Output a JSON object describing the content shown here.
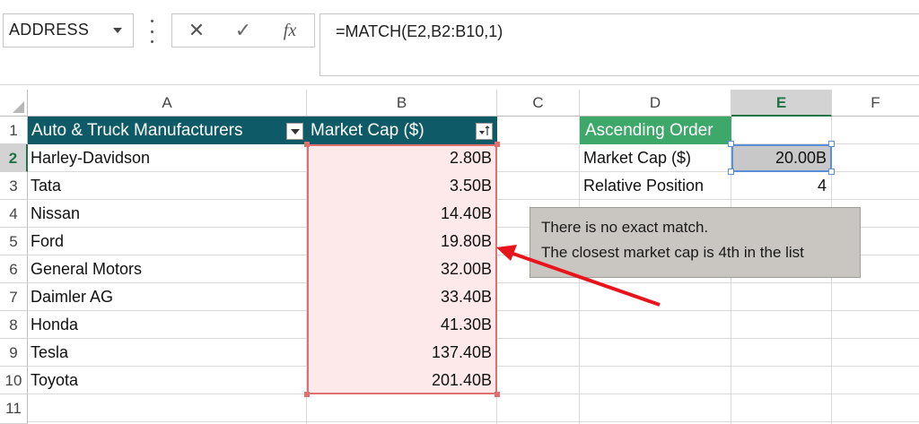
{
  "formula_bar": {
    "name_box": "ADDRESS",
    "cancel_glyph": "✕",
    "enter_glyph": "✓",
    "fx_glyph": "fx",
    "formula": "=MATCH(E2,B2:B10,1)"
  },
  "columns": [
    {
      "letter": "A",
      "selected": false
    },
    {
      "letter": "B",
      "selected": false
    },
    {
      "letter": "C",
      "selected": false
    },
    {
      "letter": "D",
      "selected": false
    },
    {
      "letter": "E",
      "selected": true
    },
    {
      "letter": "F",
      "selected": false
    }
  ],
  "rows": [
    "1",
    "2",
    "3",
    "4",
    "5",
    "6",
    "7",
    "8",
    "9",
    "10",
    "11"
  ],
  "table": {
    "header_a": "Auto & Truck Manufacturers",
    "header_b": "Market Cap ($)",
    "data": [
      {
        "name": "Harley-Davidson",
        "cap": "2.80B"
      },
      {
        "name": "Tata",
        "cap": "3.50B"
      },
      {
        "name": "Nissan",
        "cap": "14.40B"
      },
      {
        "name": "Ford",
        "cap": "19.80B"
      },
      {
        "name": "General Motors",
        "cap": "32.00B"
      },
      {
        "name": "Daimler AG",
        "cap": "33.40B"
      },
      {
        "name": "Honda",
        "cap": "41.30B"
      },
      {
        "name": "Tesla",
        "cap": "137.40B"
      },
      {
        "name": "Toyota",
        "cap": "201.40B"
      }
    ]
  },
  "lookup": {
    "title": "Ascending Order",
    "label_cap": "Market Cap ($)",
    "value_cap": "20.00B",
    "label_pos": "Relative Position",
    "value_pos": "4"
  },
  "note": {
    "line1": "There is no exact match.",
    "line2": "The closest market cap is 4th in the list"
  },
  "colors": {
    "table_header": "#0e5b67",
    "order_header": "#3ea86a",
    "highlight_fill": "#fde9e9",
    "highlight_border": "#e07070",
    "arrow": "#e8141b",
    "selection": "#5a8ed8"
  }
}
